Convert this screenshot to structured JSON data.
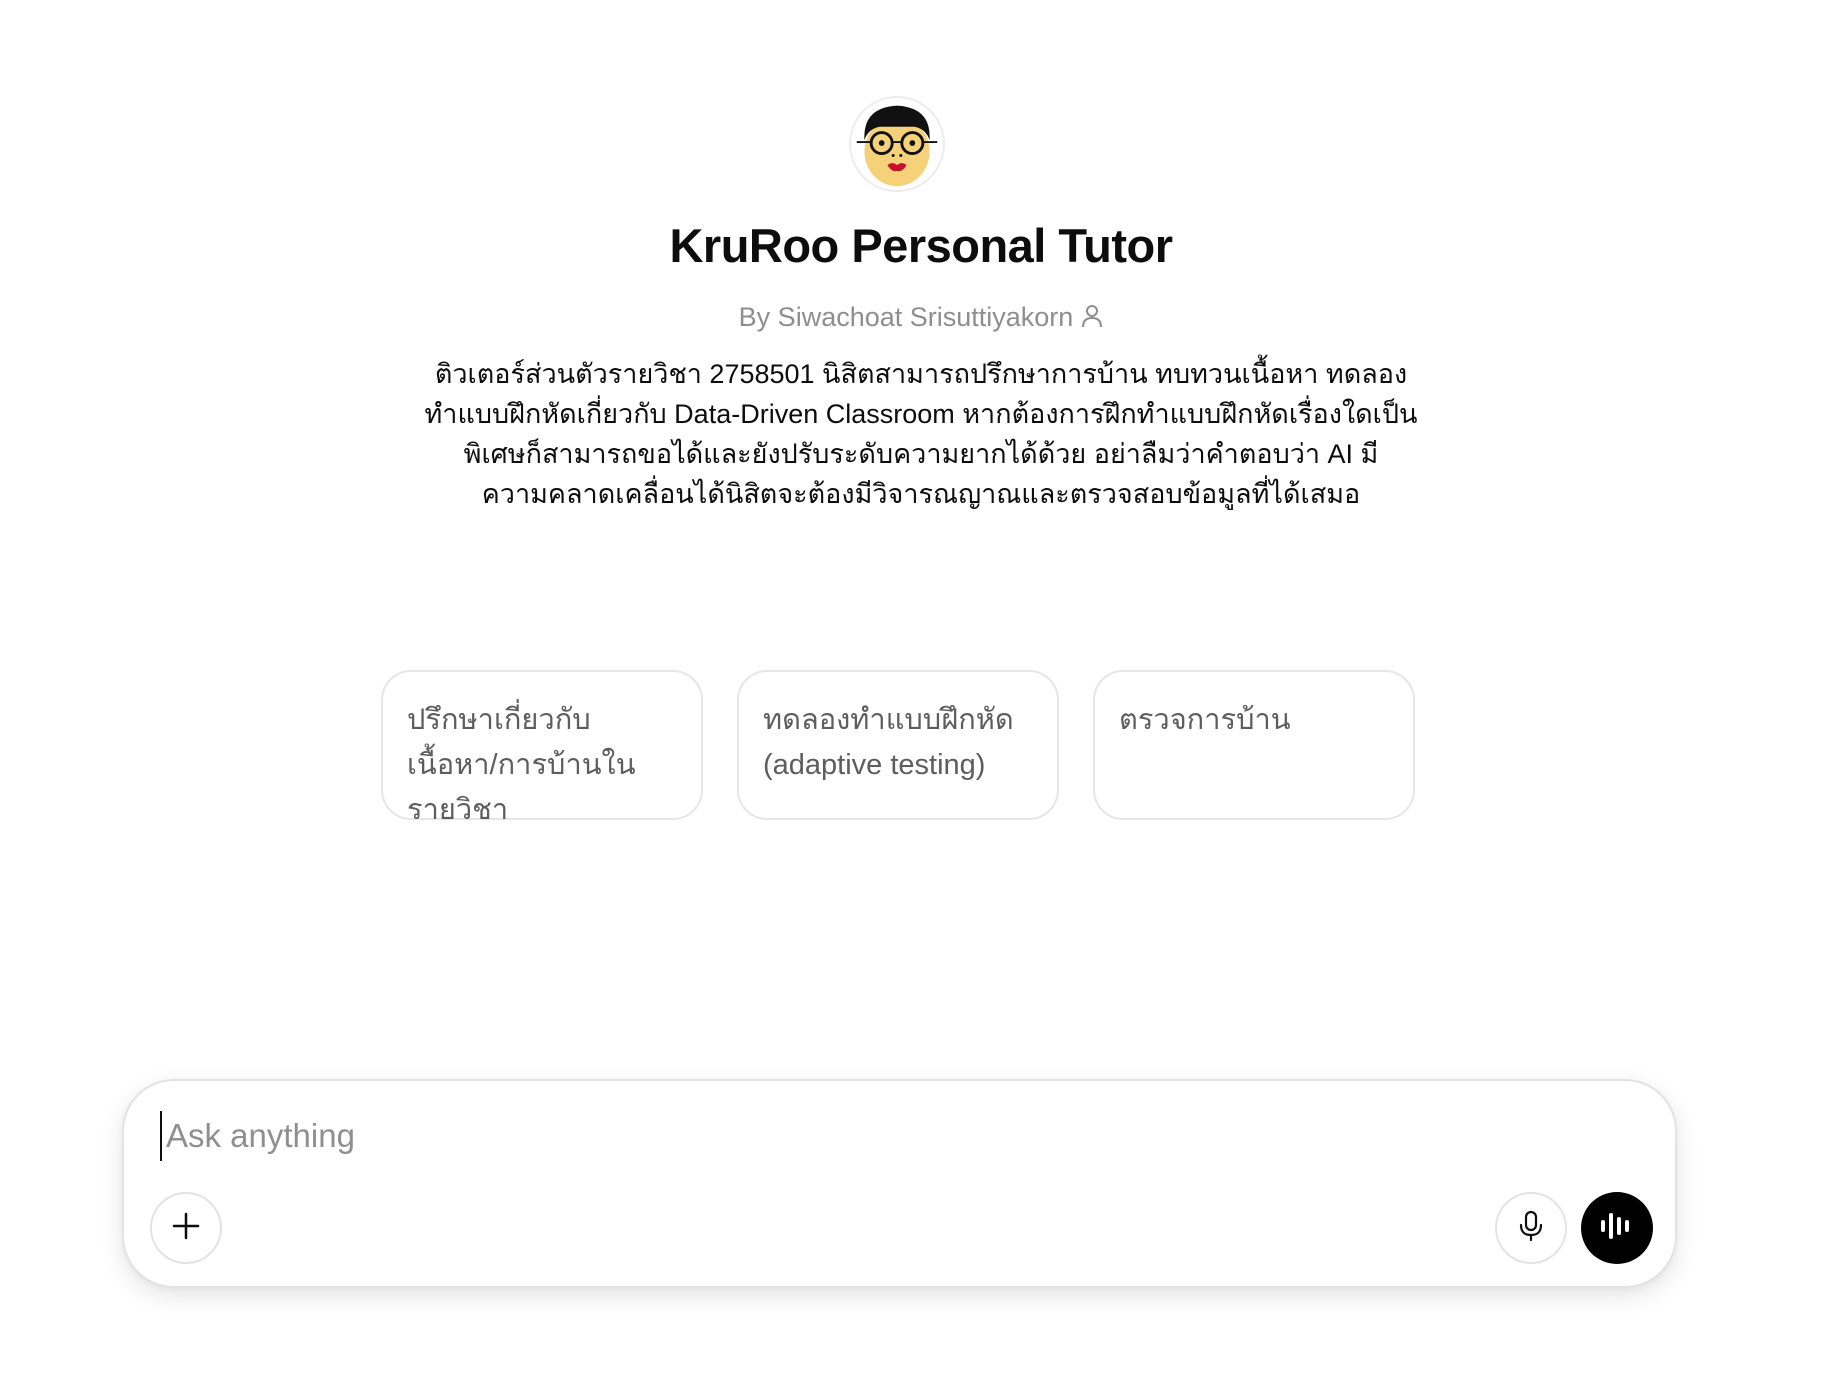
{
  "gpt": {
    "avatar_icon": "cartoon-teacher-avatar",
    "title": "KruRoo Personal Tutor",
    "byline": "By Siwachoat Srisuttiyakorn",
    "author_icon": "person-icon",
    "description": "ติวเตอร์ส่วนตัวรายวิชา 2758501 นิสิตสามารถปรึกษาการบ้าน ทบทวนเนื้อหา ทดลองทำแบบฝึกหัดเกี่ยวกับ Data-Driven Classroom หากต้องการฝึกทำแบบฝึกหัดเรื่องใดเป็นพิเศษก็สามารถขอได้และยังปรับระดับความยากได้ด้วย อย่าลืมว่าคำตอบว่า AI มีความคลาดเคลื่อนได้นิสิตจะต้องมีวิจารณญาณและตรวจสอบข้อมูลที่ได้เสมอ"
  },
  "conversation_starters": [
    {
      "label": "ปรึกษาเกี่ยวกับเนื้อหา/การบ้านในรายวิชา"
    },
    {
      "label": "ทดลองทำแบบฝึกหัด (adaptive testing)"
    },
    {
      "label": "ตรวจการบ้าน"
    }
  ],
  "composer": {
    "placeholder": "Ask anything",
    "value": "",
    "attach_icon": "plus-icon",
    "dictate_icon": "microphone-icon",
    "voice_icon": "voice-waveform-icon"
  },
  "colors": {
    "text_primary": "#0d0d0d",
    "text_secondary": "#8e8e8e",
    "starter_text": "#5d5d5d",
    "border": "#e3e3e3",
    "voice_button_bg": "#000000",
    "avatar_face": "#f5d27a",
    "avatar_lips": "#c8102e"
  }
}
